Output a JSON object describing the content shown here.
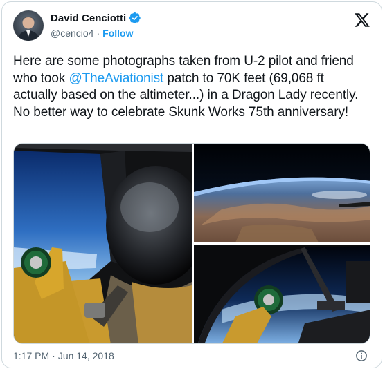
{
  "author": {
    "name": "David Cenciotti",
    "handle": "@cencio4",
    "follow_label": "Follow",
    "separator": "·",
    "verified_icon": "verified-badge-icon",
    "avatar": "profile-photo"
  },
  "brand_icon": "x-logo-icon",
  "tweet": {
    "text_before": "Here are some photographs taken from U-2 pilot and friend who took ",
    "mention": "@TheAviationist",
    "text_after": " patch to 70K feet (69,068 ft actually based on the altimeter...) in a Dragon Lady recently. No better way to celebrate Skunk Works 75th anniversary!"
  },
  "media": {
    "photos": [
      "cockpit-helmet-patch-photo",
      "earth-curvature-photo",
      "canopy-patch-photo"
    ]
  },
  "footer": {
    "time": "1:17 PM",
    "separator": "·",
    "date": "Jun 14, 2018",
    "info_icon": "info-icon"
  },
  "colors": {
    "accent": "#1d9bf0",
    "text": "#0f1419",
    "secondary": "#536471",
    "border": "#cfd9de"
  }
}
